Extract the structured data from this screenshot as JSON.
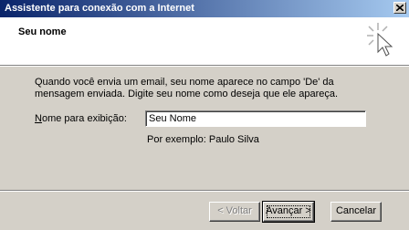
{
  "window": {
    "title": "Assistente para conexão com a Internet"
  },
  "header": {
    "title": "Seu nome"
  },
  "intro_text": "Quando você envia um email, seu nome aparece no campo 'De' da mensagem enviada. Digite seu nome como deseja que ele apareça.",
  "display_name": {
    "label_accel": "N",
    "label_rest": "ome para exibição:",
    "value": "Seu Nome",
    "example": "Por exemplo: Paulo Silva"
  },
  "buttons": {
    "back": "< Voltar",
    "next": "Avançar >",
    "cancel": "Cancelar"
  },
  "icons": {
    "header": "wizard-burst-cursor-icon",
    "close": "close-icon"
  }
}
